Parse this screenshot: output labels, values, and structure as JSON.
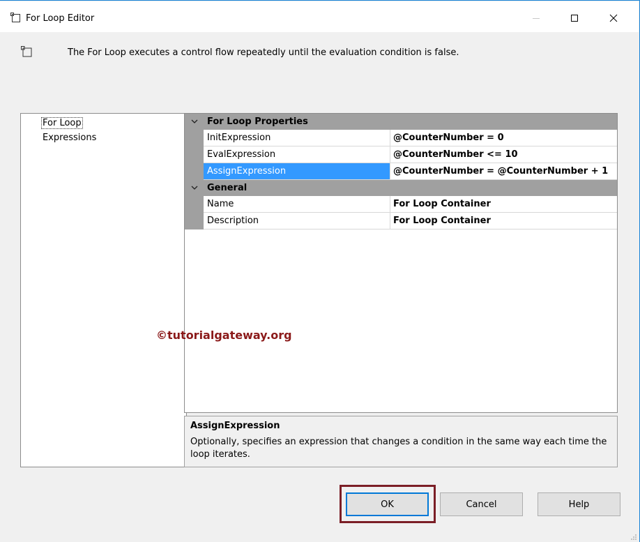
{
  "window": {
    "title": "For Loop Editor",
    "icon": "container-icon",
    "controls": {
      "minimize": "minimize-icon",
      "maximize": "maximize-icon",
      "close": "close-icon"
    }
  },
  "description": {
    "icon": "container-icon",
    "text": "The For Loop executes a control flow repeatedly until the evaluation condition is false."
  },
  "nav": {
    "items": [
      {
        "label": "For Loop",
        "selected": true
      },
      {
        "label": "Expressions",
        "selected": false
      }
    ]
  },
  "grid": {
    "categories": [
      {
        "label": "For Loop Properties",
        "rows": [
          {
            "name": "InitExpression",
            "value": "@CounterNumber = 0"
          },
          {
            "name": "EvalExpression",
            "value": "@CounterNumber <= 10"
          },
          {
            "name": "AssignExpression",
            "value": "@CounterNumber = @CounterNumber + 1"
          }
        ]
      },
      {
        "label": "General",
        "rows": [
          {
            "name": "Name",
            "value": "For Loop Container"
          },
          {
            "name": "Description",
            "value": "For Loop Container"
          }
        ]
      }
    ],
    "selected_row": "AssignExpression"
  },
  "watermark": "©tutorialgateway.org",
  "help": {
    "title": "AssignExpression",
    "body": "Optionally, specifies an expression that changes a condition in the same way each time the loop iterates."
  },
  "buttons": {
    "ok": "OK",
    "cancel": "Cancel",
    "help": "Help"
  },
  "colors": {
    "selection": "#3399ff",
    "category_bg": "#a0a0a0",
    "ok_highlight": "#7b1e26",
    "focus_border": "#0078d7"
  }
}
